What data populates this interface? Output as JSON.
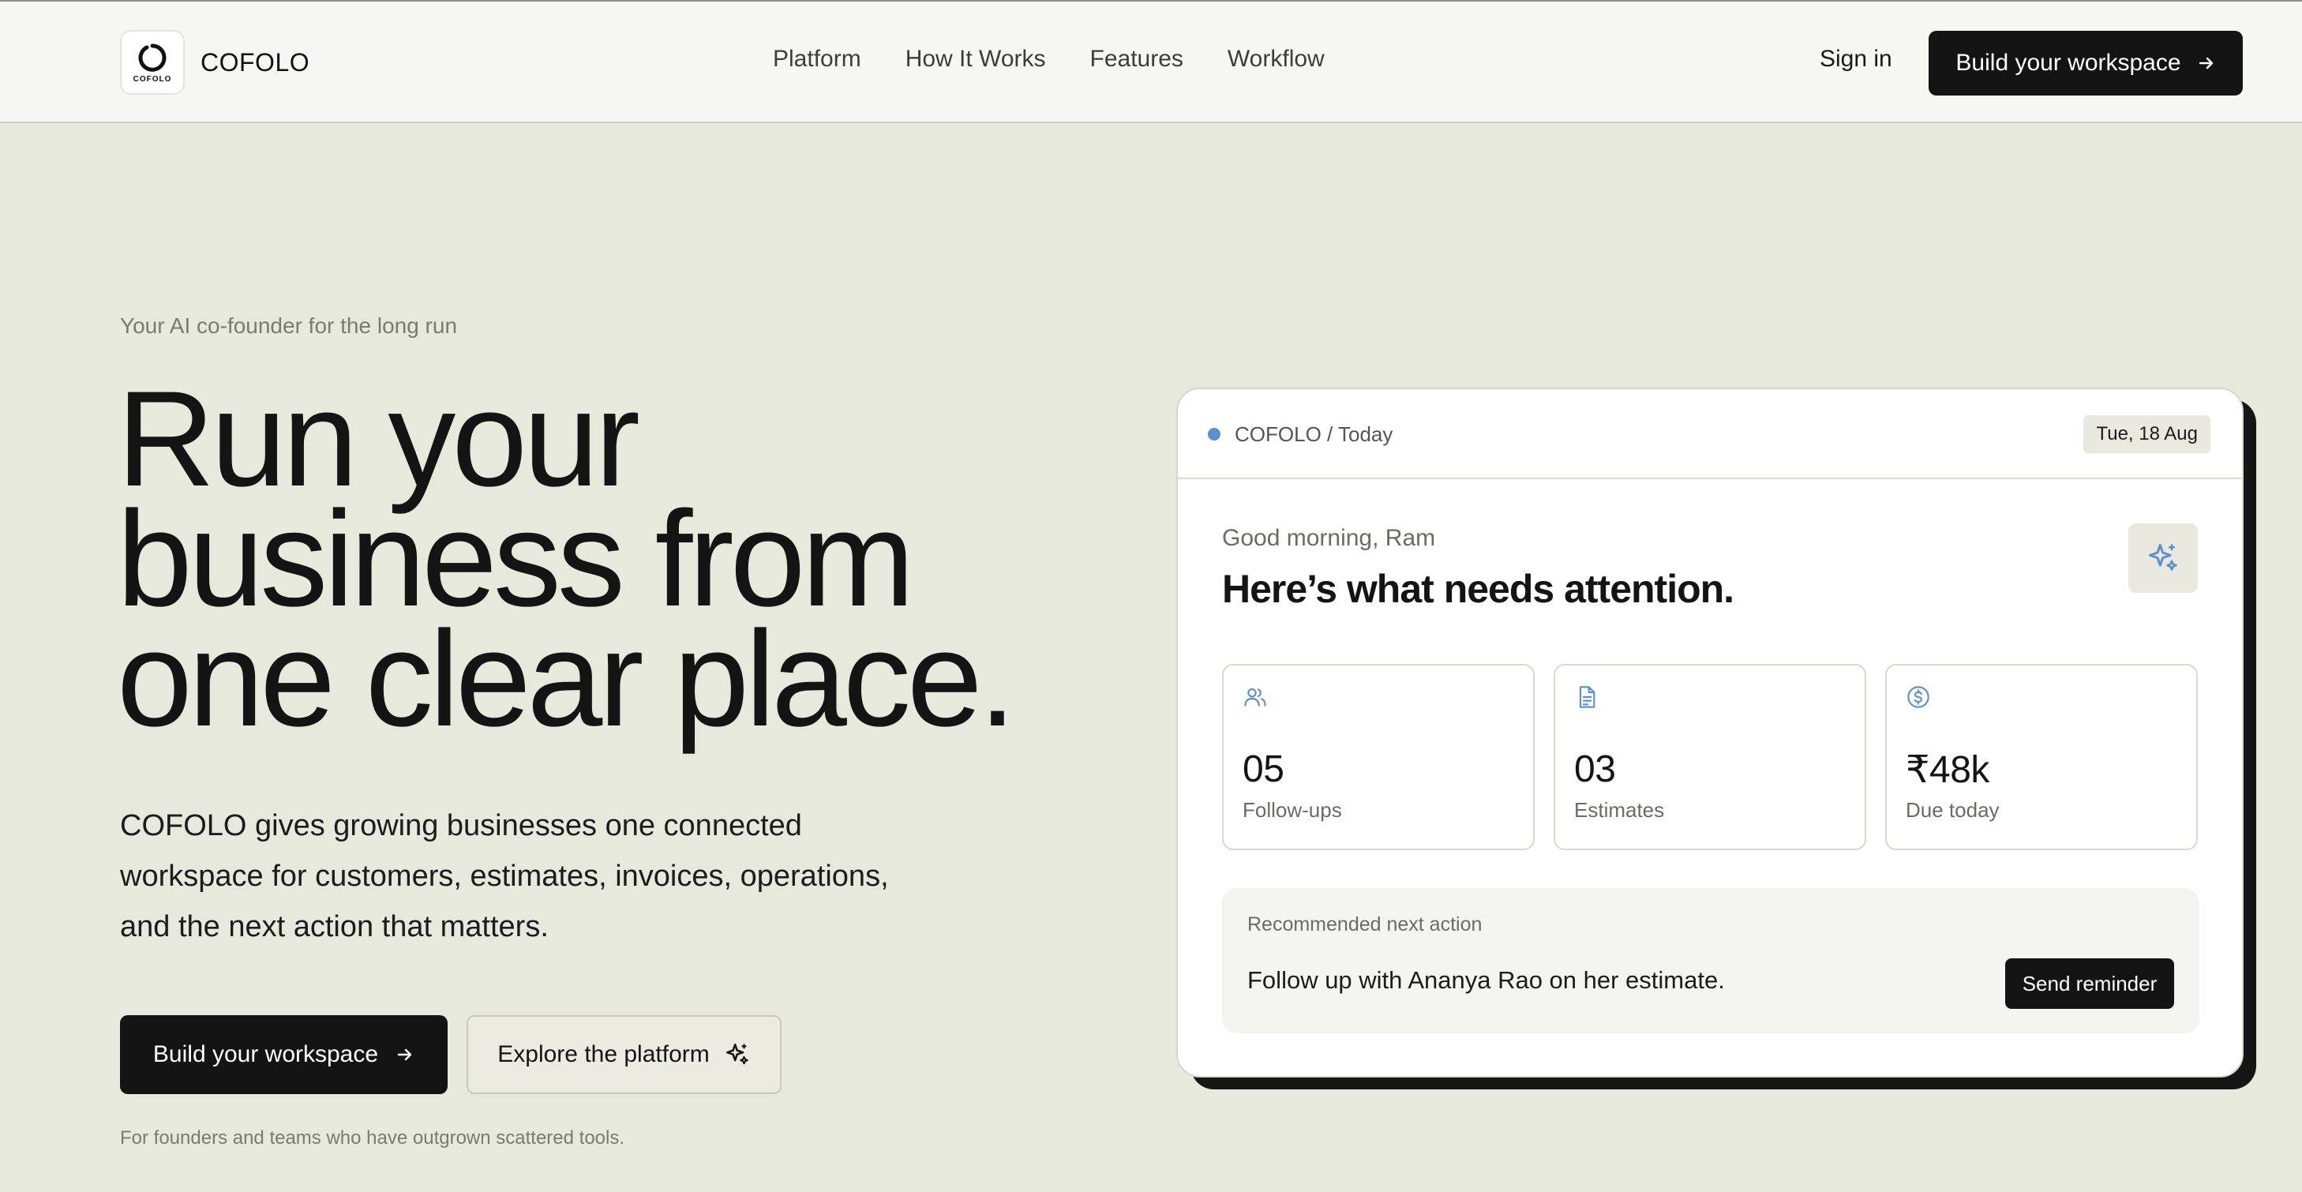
{
  "brand": {
    "name": "COFOLO",
    "logo_text": "COFOLO"
  },
  "nav": {
    "items": [
      {
        "label": "Platform"
      },
      {
        "label": "How It Works"
      },
      {
        "label": "Features"
      },
      {
        "label": "Workflow"
      }
    ],
    "sign_in": "Sign in",
    "cta": "Build your workspace"
  },
  "hero": {
    "eyebrow": "Your AI co-founder for the long run",
    "headline": [
      "Run your",
      "business from",
      "one clear place."
    ],
    "subtext": "COFOLO gives growing businesses one connected workspace for customers, estimates, invoices, operations, and the next action that matters.",
    "primary_cta": "Build your workspace",
    "secondary_cta": "Explore the platform",
    "footnote": "For founders and teams who have outgrown scattered tools."
  },
  "dashboard": {
    "breadcrumb": "COFOLO / Today",
    "date": "Tue, 18 Aug",
    "greeting": "Good morning, Ram",
    "title": "Here’s what needs attention.",
    "stats": [
      {
        "icon": "users-icon",
        "value": "05",
        "label": "Follow-ups"
      },
      {
        "icon": "document-icon",
        "value": "03",
        "label": "Estimates"
      },
      {
        "icon": "dollar-icon",
        "value": "₹48k",
        "label": "Due today"
      }
    ],
    "recommendation": {
      "heading": "Recommended next action",
      "text": "Follow up with Ananya Rao on her estimate.",
      "button": "Send reminder"
    }
  },
  "colors": {
    "page_bg": "#e8e9dd",
    "header_bg": "#f6f6f3",
    "primary": "#141414",
    "accent_icon": "#5a8fd6"
  }
}
